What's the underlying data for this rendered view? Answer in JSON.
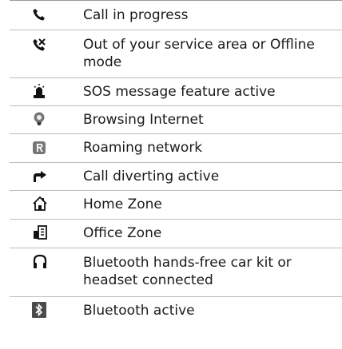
{
  "indicators": [
    {
      "icon": "call-in-progress-icon",
      "text": "Call in progress"
    },
    {
      "icon": "no-service-icon",
      "text": "Out of your service area or Offline mode"
    },
    {
      "icon": "sos-icon",
      "text": "SOS message feature active"
    },
    {
      "icon": "browsing-internet-icon",
      "text": "Browsing Internet"
    },
    {
      "icon": "roaming-icon",
      "text": "Roaming network"
    },
    {
      "icon": "call-divert-icon",
      "text": "Call diverting active"
    },
    {
      "icon": "home-zone-icon",
      "text": "Home Zone"
    },
    {
      "icon": "office-zone-icon",
      "text": "Office Zone"
    },
    {
      "icon": "bluetooth-headset-icon",
      "text": "Bluetooth hands-free car kit or headset connected"
    },
    {
      "icon": "bluetooth-icon",
      "text": "Bluetooth active"
    }
  ]
}
